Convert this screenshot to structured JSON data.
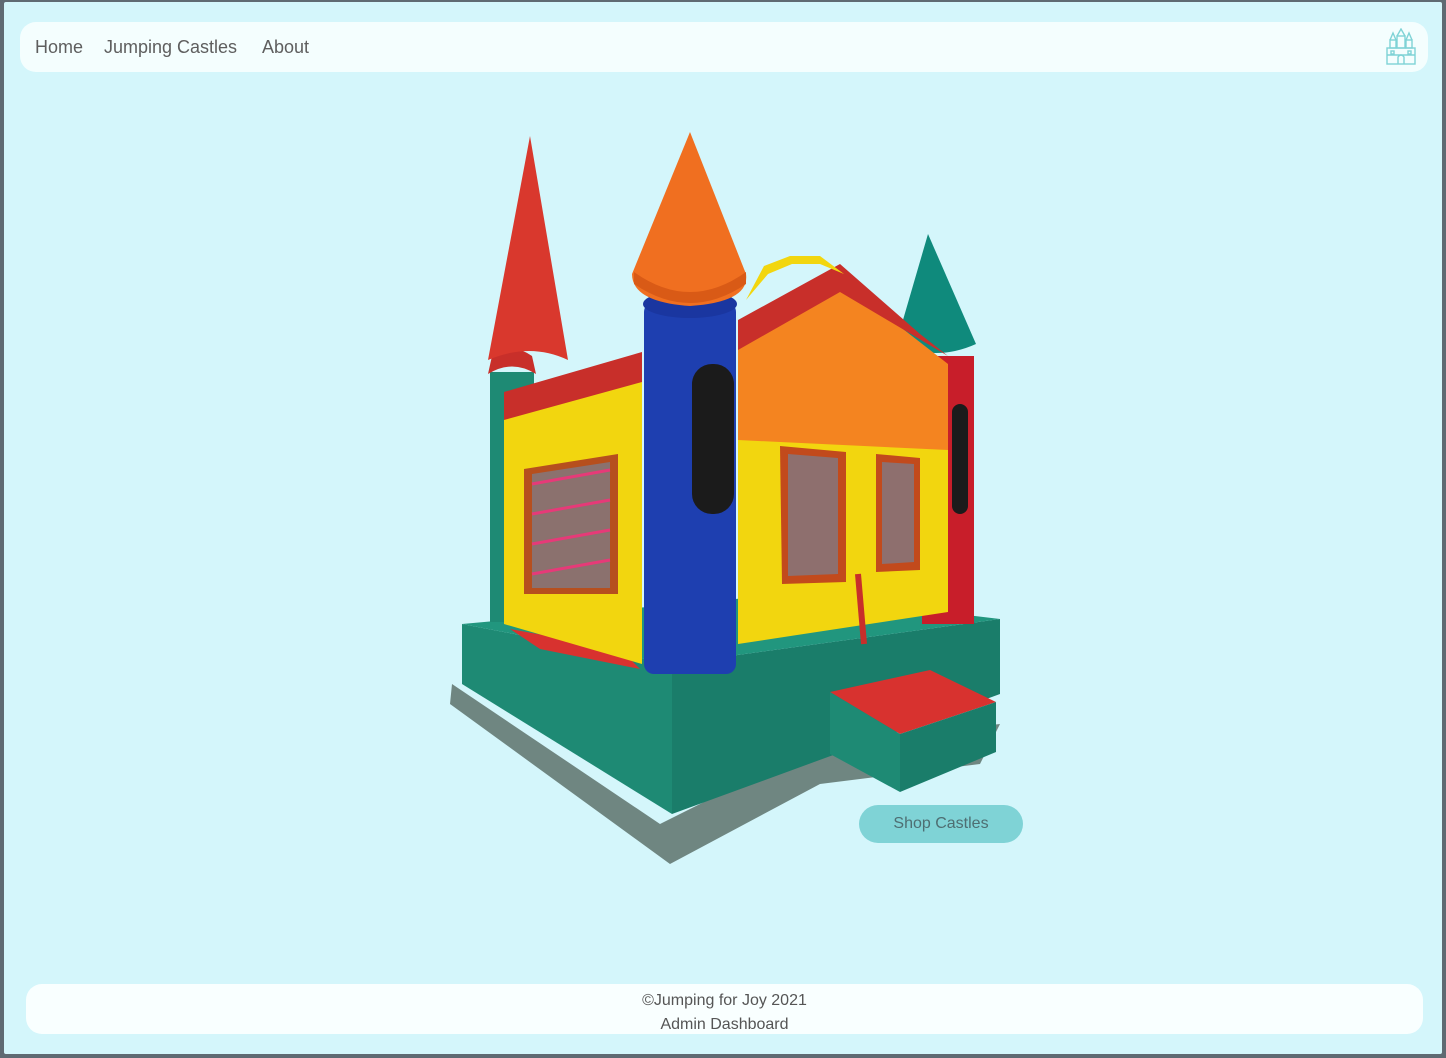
{
  "nav": {
    "links": [
      "Home",
      "Jumping Castles",
      "About"
    ]
  },
  "logo": {
    "icon": "castle-logo-icon",
    "color": "#7fd3d6"
  },
  "hero": {
    "image": "inflatable-bounce-castle"
  },
  "cta": {
    "label": "Shop Castles",
    "color": "#7fd3d6"
  },
  "footer": {
    "copyright": "©Jumping for Joy 2021",
    "admin_link": "Admin Dashboard"
  },
  "colors": {
    "background": "#d4f6fb",
    "bar": "#f4fefe"
  }
}
